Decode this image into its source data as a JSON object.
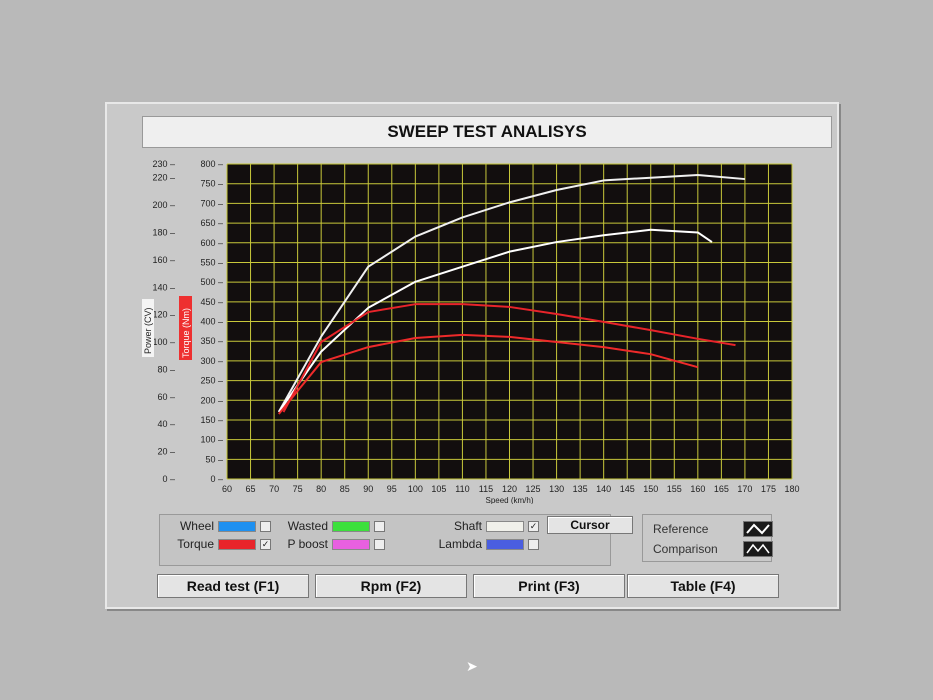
{
  "title": "SWEEP TEST ANALISYS",
  "legend": [
    {
      "label": "Wheel",
      "color": "#1e90f0",
      "checked": false
    },
    {
      "label": "Torque",
      "color": "#e8242a",
      "checked": true
    },
    {
      "label": "Wasted",
      "color": "#3ce03c",
      "checked": false
    },
    {
      "label": "P boost",
      "color": "#e860e0",
      "checked": false
    },
    {
      "label": "Shaft",
      "color": "#f0f0ea",
      "checked": true
    },
    {
      "label": "Lambda",
      "color": "#4a5ee0",
      "checked": false
    }
  ],
  "cursor_label": "Cursor",
  "reference": {
    "reference_label": "Reference",
    "comparison_label": "Comparison"
  },
  "buttons": [
    "Read test (F1)",
    "Rpm (F2)",
    "Print (F3)",
    "Table (F4)"
  ],
  "check_mark": "✓",
  "chart_data": {
    "type": "line",
    "xlabel": "Speed (km/h)",
    "ylabel_power": "Power (CV)",
    "ylabel_torque": "Torque (Nm)",
    "xlim": [
      60,
      180
    ],
    "xticks": [
      60,
      65,
      70,
      75,
      80,
      85,
      90,
      95,
      100,
      105,
      110,
      115,
      120,
      125,
      130,
      135,
      140,
      145,
      150,
      155,
      160,
      165,
      170,
      175,
      180
    ],
    "ylim_torque": [
      0,
      800
    ],
    "yticks_torque": [
      0,
      50,
      100,
      150,
      200,
      250,
      300,
      350,
      400,
      450,
      500,
      550,
      600,
      650,
      700,
      750,
      800
    ],
    "ylim_power": [
      0,
      230
    ],
    "yticks_power": [
      0,
      20,
      40,
      60,
      80,
      100,
      120,
      140,
      160,
      180,
      200,
      220,
      230
    ],
    "grid": true,
    "series": [
      {
        "name": "Shaft power (reference)",
        "axis": "power",
        "color": "#f0f0f0",
        "x": [
          71,
          80,
          90,
          100,
          110,
          120,
          130,
          140,
          150,
          160,
          170
        ],
        "y": [
          49,
          104,
          155,
          177,
          191,
          202,
          211,
          218,
          220,
          222,
          219
        ]
      },
      {
        "name": "Shaft power (comparison)",
        "axis": "power",
        "color": "#ffffff",
        "x": [
          71,
          80,
          90,
          100,
          110,
          120,
          130,
          140,
          150,
          160,
          163
        ],
        "y": [
          49,
          93,
          125,
          144,
          155,
          166,
          173,
          178,
          182,
          180,
          173
        ]
      },
      {
        "name": "Torque (reference)",
        "axis": "torque",
        "color": "#e8242a",
        "x": [
          72,
          80,
          90,
          100,
          110,
          120,
          130,
          140,
          150,
          160,
          168
        ],
        "y": [
          170,
          348,
          424,
          444,
          444,
          437,
          419,
          399,
          378,
          356,
          340
        ]
      },
      {
        "name": "Torque (comparison)",
        "axis": "torque",
        "color": "#ee2a2a",
        "x": [
          71,
          80,
          90,
          100,
          110,
          120,
          130,
          140,
          150,
          160
        ],
        "y": [
          165,
          297,
          335,
          358,
          366,
          361,
          348,
          335,
          317,
          284
        ]
      }
    ]
  }
}
